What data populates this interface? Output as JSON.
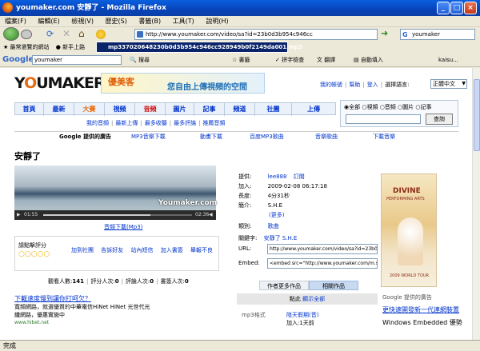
{
  "window": {
    "title": "youmaker.com 安靜了 - Mozilla Firefox",
    "min": "_",
    "max": "□",
    "close": "×"
  },
  "menu": [
    "檔案(F)",
    "編輯(E)",
    "檢視(V)",
    "歷史(S)",
    "書籤(B)",
    "工具(T)",
    "說明(H)"
  ],
  "nav": {
    "url": "http://www.youmaker.com/video/sa?id=23b0d3b954c946cc",
    "search_value": "youmaker"
  },
  "bookmarks": {
    "most_visited": "最常瀏覽的網站",
    "getting_started": "新手上路",
    "tooltip_url": "mp337020648230b0d3b954c946cc928949b0f2149da001.mp3"
  },
  "gtoolbar": {
    "logo": "Google",
    "search_value": "youmaker",
    "search_btn": "搜尋",
    "bookmarks": "書籤",
    "spell": "拼字檢查",
    "translate": "翻譯",
    "autofill": "自動填入",
    "user": "kaisu..."
  },
  "page": {
    "logo_you": "Y",
    "logo_rest": "UMAKER",
    "banner_brand": "優美客",
    "banner_slogan": "您自由上傳視頻的空間",
    "top_links": [
      "我的帳號",
      "幫助",
      "登入"
    ],
    "lang_label": "選擇語言:",
    "lang_value": "正體中文",
    "tabs": [
      "首頁",
      "最新",
      "大賽",
      "視頻",
      "音頻",
      "圖片",
      "記事",
      "頻道",
      "社團",
      "上傳"
    ],
    "subnav": [
      "我的音頻",
      "最新上傳",
      "最多收聽",
      "最多評論",
      "推薦音頻"
    ],
    "search_options": [
      "全部",
      "視頻",
      "音頻",
      "圖片",
      "記事"
    ],
    "search_btn": "查詢",
    "ads_label": "Google 提供的廣告",
    "ad_links": [
      "MP3音樂下載",
      "動畫下載",
      "百度MP3歌曲",
      "音樂歌曲",
      "下載音樂"
    ],
    "title": "安靜了",
    "player": {
      "brand": "Youmaker.com",
      "time_current": "01:55",
      "time_total": "02:36",
      "progress": 0.72
    },
    "download_mp3": "音頻下載(Mp3)",
    "info": {
      "provider_lbl": "提供:",
      "provider": "lee888",
      "subscribe": "訂閱",
      "added_lbl": "加入:",
      "added": "2009-02-08 06:17:18",
      "length_lbl": "長度:",
      "length": "4分31秒",
      "intro_lbl": "簡介:",
      "intro": "S.H.E",
      "more": "(更多)",
      "category_lbl": "類別:",
      "category": "歌曲",
      "keywords_lbl": "關鍵字:",
      "keywords": "安靜了 S.H.E",
      "url_lbl": "URL:",
      "url": "http://www.youmaker.com/video/sa?id=23b0d",
      "embed_lbl": "Embed:",
      "embed": "<embed src=\"http://www.youmaker.com/m.s"
    },
    "author_more": "作者更多作品",
    "related": "相關作品",
    "rating_label": "請點擊評分",
    "actions": [
      "加到社團",
      "告訴好友",
      "站內短信",
      "加入書簽",
      "舉報不良"
    ],
    "stats": {
      "views_lbl": "觀看人數:",
      "views": "141",
      "raters_lbl": "評分人次:",
      "raters": "0",
      "comments_lbl": "評論人次:",
      "comments": "0",
      "bookmarks_lbl": "書簽人次:",
      "bookmarks": "0"
    },
    "bottom_ad": {
      "title": "下載速度慢到讓你打呵欠？",
      "line1": "寬頻網路，就選優質的中華電信HiNet HiNet 光世代光",
      "line2": "纖網路，優惠實施中",
      "url": "www.hibet.net"
    },
    "list": {
      "header_a": "點此",
      "header_b": "顯示全部",
      "format_lbl": "mp3格式",
      "item_title": "陰天假期(音)",
      "item_added": "加入:1天前"
    },
    "side_ad": {
      "brand": "DIVINE",
      "sub": "PERFORMING ARTS",
      "tour": "2009 WORLD TOUR"
    },
    "google_ads_label": "Google 提供的廣告",
    "right_ad": {
      "title": "更快速開發新一代連網裝置",
      "line": "Windows Embedded 優勢"
    }
  },
  "status": "完成"
}
